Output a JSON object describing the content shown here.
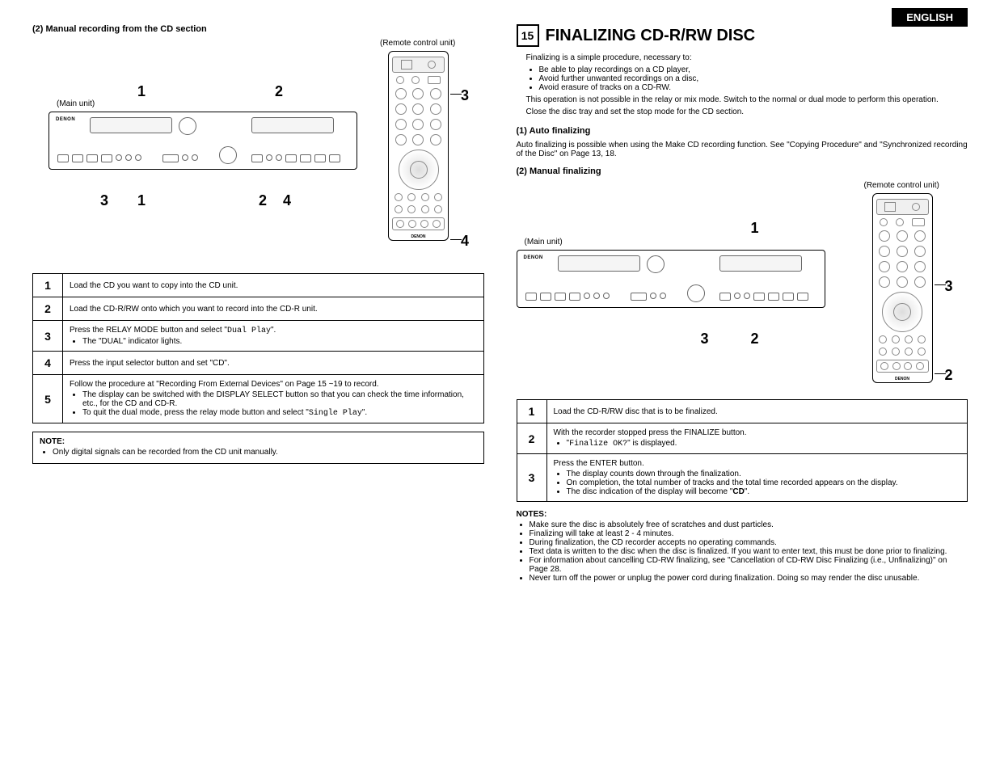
{
  "header": {
    "language": "ENGLISH"
  },
  "left": {
    "subtitle": "(2) Manual recording from the CD section",
    "remote_label": "(Remote control unit)",
    "main_label": "(Main unit)",
    "brand": "DENON",
    "callouts_top": {
      "c1": "1",
      "c2": "2",
      "c3": "3"
    },
    "callouts_bottom": {
      "c1": "3",
      "c2": "1",
      "c3": "2",
      "c4": "4",
      "c5": "4"
    },
    "steps": [
      {
        "n": "1",
        "text": "Load the CD you want to copy into the CD unit."
      },
      {
        "n": "2",
        "text": "Load the CD-R/RW onto which you want to record into the CD-R unit."
      },
      {
        "n": "3",
        "text": "Press the RELAY MODE button and select \"",
        "mono": "Dual Play",
        "text2": "\".",
        "bullets": [
          "The \"DUAL\" indicator lights."
        ]
      },
      {
        "n": "4",
        "text": "Press the input selector button and set \"CD\"."
      },
      {
        "n": "5",
        "text": "Follow the procedure at \"Recording From External Devices\" on Page 15 ~19 to record.",
        "bullets": [
          "The display can be switched with the DISPLAY SELECT button so that you can check the time information, etc., for the CD and CD-R.",
          "To quit the dual mode, press the relay mode button and select \""
        ],
        "mono2": "Single Play",
        "text3": "\"."
      }
    ],
    "note": {
      "title": "NOTE:",
      "items": [
        "Only digital signals can be recorded from the CD unit manually."
      ]
    }
  },
  "right": {
    "section_num": "15",
    "section_title": "FINALIZING CD-R/RW DISC",
    "intro_lead": "Finalizing is a simple procedure, necessary to:",
    "intro_bullets": [
      "Be able to play recordings on a CD player,",
      "Avoid further unwanted recordings on a disc,",
      "Avoid erasure of tracks on a CD-RW."
    ],
    "intro_p1": "This operation is not possible in the relay or mix mode.  Switch to the normal or dual mode to perform this operation.",
    "intro_p2": "Close the disc tray and set the stop mode for the CD section.",
    "auto_title": "(1) Auto finalizing",
    "auto_text": "Auto finalizing is possible when using the Make CD recording function. See \"Copying Procedure\" and \"Synchronized recording of the Disc\" on Page 13, 18.",
    "manual_title": "(2) Manual finalizing",
    "remote_label": "(Remote control unit)",
    "main_label": "(Main unit)",
    "brand": "DENON",
    "callouts": {
      "c1": "1",
      "c2": "2",
      "c3": "3",
      "c_right3": "3",
      "c_right2": "2"
    },
    "steps": [
      {
        "n": "1",
        "text": "Load the CD-R/RW disc that is to be finalized."
      },
      {
        "n": "2",
        "text": "With the recorder stopped press the FINALIZE button.",
        "bullets_pre": "\"",
        "mono": "Finalize OK?",
        "bullets_post": "\" is displayed."
      },
      {
        "n": "3",
        "text": "Press the ENTER button.",
        "bullets": [
          "The display counts down through the finalization.",
          "On completion, the total number of tracks and the total time recorded appears on the display."
        ],
        "last_bullet_pre": "The disc indication of the display will become \"",
        "last_bullet_bold": "CD",
        "last_bullet_post": "\"."
      }
    ],
    "notes": {
      "title": "NOTES:",
      "items": [
        "Make sure the disc is absolutely free of scratches and dust particles.",
        "Finalizing will take at least 2 - 4 minutes.",
        "During finalization, the CD recorder accepts no operating commands.",
        "Text data is written to the disc when the disc is finalized. If you want to enter text, this must be done prior to finalizing.",
        "For information about cancelling CD-RW finalizing, see \"Cancellation of CD-RW Disc Finalizing (i.e., Unfinalizing)\" on Page 28.",
        "Never turn off the power or unplug the power cord during finalization.  Doing so may render the disc unusable."
      ]
    }
  }
}
